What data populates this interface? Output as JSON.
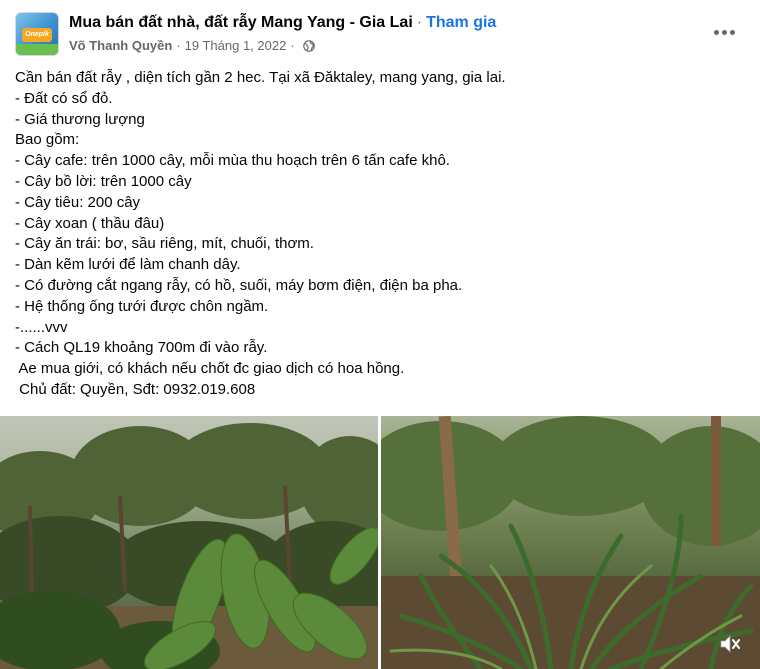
{
  "header": {
    "group_name": "Mua bán đất nhà, đất rẫy Mang Yang - Gia Lai",
    "separator": "·",
    "join_label": "Tham gia",
    "author": "Võ Thanh Quyền",
    "date": "19 Tháng 1, 2022",
    "avatar_text": "Onepik",
    "privacy_icon": "globe-icon",
    "more_icon": "more-options-icon"
  },
  "post": {
    "lines": [
      "Cần bán đất rẫy , diện tích gần 2 hec. Tại xã Đăktaley, mang yang, gia lai.",
      "- Đất có sổ đỏ.",
      "- Giá thương lượng",
      "Bao gồm:",
      "- Cây cafe: trên 1000 cây, mỗi mùa thu hoạch trên 6 tấn cafe khô.",
      "- Cây bồ lời: trên 1000 cây",
      "- Cây tiêu: 200 cây",
      "- Cây xoan ( thầu đâu)",
      "- Cây ăn trái: bơ, sầu riêng, mít, chuối, thơm.",
      "- Dàn kẽm lưới để làm chanh dây.",
      "- Có đường cắt ngang rẫy, có hồ, suối, máy bơm điện, điện ba pha.",
      "- Hệ thống ống tưới được chôn ngầm.",
      "-......vvv",
      "- Cách QL19 khoảng 700m đi vào rẫy.",
      " Ae mua giới, có khách nếu chốt đc giao dịch có hoa hồng.",
      " Chủ đất: Quyền, Sđt: 0932.019.608"
    ]
  },
  "media": {
    "photos": [
      "coffee-plantation-photo",
      "pineapple-field-photo"
    ],
    "mute_icon": "volume-mute-icon"
  }
}
